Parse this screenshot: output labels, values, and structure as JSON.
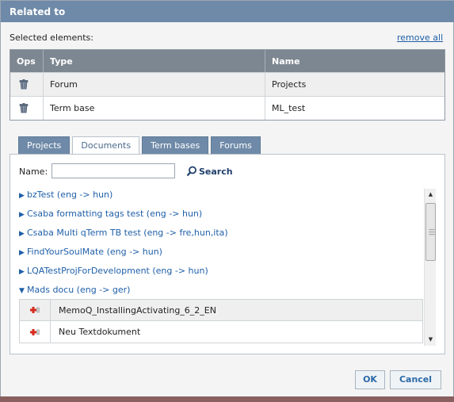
{
  "dialog": {
    "title": "Related to"
  },
  "selected": {
    "label": "Selected elements:",
    "remove_all": "remove all",
    "columns": [
      "Ops",
      "Type",
      "Name"
    ],
    "rows": [
      {
        "type": "Forum",
        "name": "Projects"
      },
      {
        "type": "Term base",
        "name": "ML_test"
      }
    ]
  },
  "tabs": [
    "Projects",
    "Documents",
    "Term bases",
    "Forums"
  ],
  "active_tab": "Documents",
  "search": {
    "name_label": "Name:",
    "name_value": "",
    "search_label": "Search"
  },
  "list": {
    "items": [
      {
        "label": "bzTest (eng -> hun)",
        "expanded": false
      },
      {
        "label": "Csaba formatting tags test (eng -> hun)",
        "expanded": false
      },
      {
        "label": "Csaba Multi qTerm TB test (eng -> fre,hun,ita)",
        "expanded": false
      },
      {
        "label": "FindYourSoulMate (eng -> hun)",
        "expanded": false
      },
      {
        "label": "LQATestProjForDevelopment (eng -> hun)",
        "expanded": false
      },
      {
        "label": "Mads docu (eng -> ger)",
        "expanded": true
      }
    ],
    "documents": [
      {
        "name": "MemoQ_InstallingActivating_6_2_EN"
      },
      {
        "name": "Neu Textdokument"
      }
    ]
  },
  "buttons": {
    "ok": "OK",
    "cancel": "Cancel"
  },
  "icons": {
    "collapsed": "triangle-right-icon",
    "expanded": "triangle-down-icon",
    "delete": "trash-icon",
    "add": "add-plus-icon",
    "search": "magnifier-icon"
  },
  "colors": {
    "titlebar": "#6f8aa8",
    "link": "#1f5fa8",
    "table_header": "#7d8791"
  }
}
